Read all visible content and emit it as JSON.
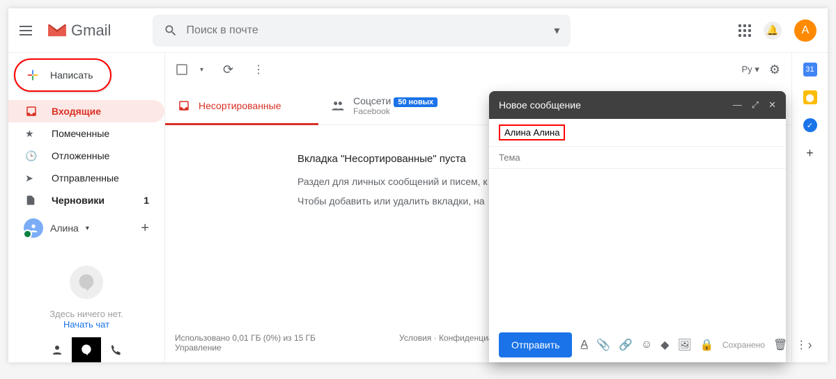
{
  "header": {
    "product": "Gmail",
    "search_placeholder": "Поиск в почте",
    "avatar_letter": "A"
  },
  "sidebar": {
    "compose_label": "Написать",
    "items": [
      {
        "label": "Входящие",
        "active": true
      },
      {
        "label": "Помеченные"
      },
      {
        "label": "Отложенные"
      },
      {
        "label": "Отправленные"
      },
      {
        "label": "Черновики",
        "count": "1"
      }
    ],
    "user_name": "Алина",
    "hangout_empty": "Здесь ничего нет.",
    "hangout_link": "Начать чат"
  },
  "toolbar": {
    "lang": "Py"
  },
  "tabs": {
    "primary": "Несортированные",
    "social": "Соцсети",
    "social_badge": "50 новых",
    "social_sub": "Facebook"
  },
  "empty": {
    "title": "Вкладка \"Несортированные\" пуста",
    "line1": "Раздел для личных сообщений и писем, к",
    "line2": "Чтобы добавить или удалить вкладки, на"
  },
  "footer": {
    "storage": "Использовано 0,01 ГБ (0%) из 15 ГБ",
    "manage": "Управление",
    "terms": "Условия",
    "privacy": "Конфиденциальн"
  },
  "compose": {
    "title": "Новое сообщение",
    "recipient": "Алина Алина",
    "subject_placeholder": "Тема",
    "send_label": "Отправить",
    "saved": "Сохранено"
  }
}
